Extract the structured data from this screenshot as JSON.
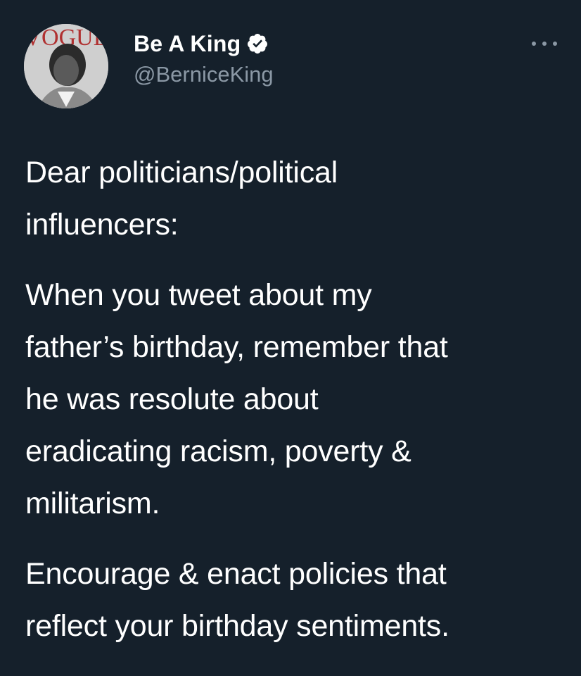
{
  "author": {
    "display_name": "Be A King",
    "handle": "@BerniceKing",
    "avatar_text": "VOGUE",
    "verified_icon": "verified-badge-icon"
  },
  "tweet": {
    "paragraphs": [
      "Dear politicians/political\ninfluencers:",
      "When you tweet about my\nfather’s birthday, remember that\nhe was resolute about\neradicating racism, poverty &\nmilitarism.",
      "Encourage & enact policies that\nreflect your birthday sentiments."
    ]
  },
  "colors": {
    "background": "#15202b",
    "text": "#ffffff",
    "secondary_text": "#8b98a5"
  }
}
